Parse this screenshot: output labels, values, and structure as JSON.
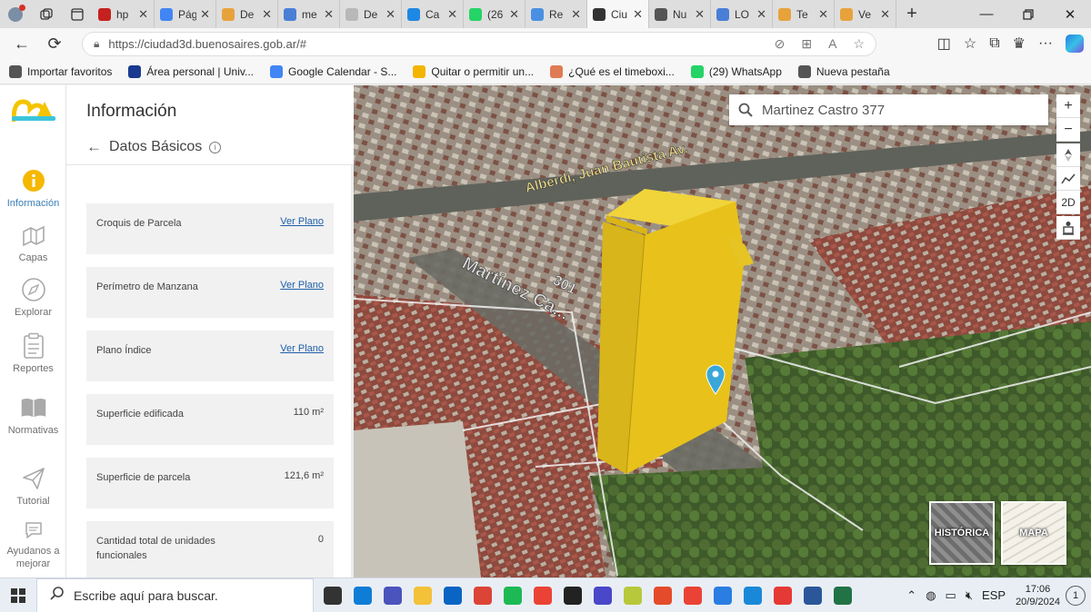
{
  "browser": {
    "tabs": [
      {
        "label": "hp",
        "color": "#c5221f"
      },
      {
        "label": "Pág",
        "color": "#4285f4"
      },
      {
        "label": "De",
        "color": "#e8a23c"
      },
      {
        "label": "me",
        "color": "#4a7fd6"
      },
      {
        "label": "De",
        "color": "#b8b8b8"
      },
      {
        "label": "Ca",
        "color": "#1e88e5"
      },
      {
        "label": "(26",
        "color": "#25d366"
      },
      {
        "label": "Re",
        "color": "#4a90e2"
      },
      {
        "label": "Ciu",
        "color": "#333333"
      },
      {
        "label": "Nu",
        "color": "#555555"
      },
      {
        "label": "LO",
        "color": "#4a7fd6"
      },
      {
        "label": "Te",
        "color": "#e8a23c"
      },
      {
        "label": "Ve",
        "color": "#e8a23c"
      }
    ],
    "active_tab_index": 8,
    "url": "https://ciudad3d.buenosaires.gob.ar/#",
    "favorites": [
      {
        "label": "Importar favoritos",
        "color": "#555555"
      },
      {
        "label": "Área personal | Univ...",
        "color": "#1a3a8f"
      },
      {
        "label": "Google Calendar - S...",
        "color": "#4285f4"
      },
      {
        "label": "Quitar o permitir un...",
        "color": "#f4b400"
      },
      {
        "label": "¿Qué es el timeboxi...",
        "color": "#e07b53"
      },
      {
        "label": "(29) WhatsApp",
        "color": "#25d366"
      },
      {
        "label": "Nueva pestaña",
        "color": "#555555"
      }
    ]
  },
  "rail": {
    "items": [
      {
        "label": "Información",
        "icon": "info-icon"
      },
      {
        "label": "Capas",
        "icon": "layers-icon"
      },
      {
        "label": "Explorar",
        "icon": "compass-icon"
      },
      {
        "label": "Reportes",
        "icon": "clipboard-icon"
      },
      {
        "label": "Normativas",
        "icon": "book-icon"
      },
      {
        "label": "Tutorial",
        "icon": "send-icon"
      },
      {
        "label": "Ayudanos a mejorar",
        "icon": "chat-icon"
      }
    ],
    "accent": "#f5b800"
  },
  "panel": {
    "title": "Información",
    "subtitle": "Datos Básicos",
    "rows": [
      {
        "label": "Croquis de Parcela",
        "value": "Ver Plano",
        "link": true
      },
      {
        "label": "Perímetro de Manzana",
        "value": "Ver Plano",
        "link": true
      },
      {
        "label": "Plano Índice",
        "value": "Ver Plano",
        "link": true
      },
      {
        "label": "Superficie edificada",
        "value": "110 m²",
        "link": false
      },
      {
        "label": "Superficie de parcela",
        "value": "121,6 m²",
        "link": false
      },
      {
        "label": "Cantidad total de unidades funcionales",
        "value": "0",
        "link": false
      }
    ]
  },
  "map": {
    "search_value": "Martinez Castro 377",
    "street_labels": [
      "Alberdi, Juan Bautista Av.",
      "Martinez Ca...",
      "301"
    ],
    "controls": [
      "+",
      "−",
      "2D"
    ],
    "minimaps": [
      "HISTÓRICA",
      "MAPA"
    ],
    "building_color": "#e8c21a"
  },
  "taskbar": {
    "search_placeholder": "Escribe aquí para buscar.",
    "language": "ESP",
    "time": "17:06",
    "date": "20/9/2024",
    "notifications": "1",
    "apps": [
      {
        "name": "task-view",
        "color": "#333333"
      },
      {
        "name": "edge",
        "color": "#0f7dd6"
      },
      {
        "name": "teams",
        "color": "#4b53bc"
      },
      {
        "name": "file-explorer",
        "color": "#f3c238"
      },
      {
        "name": "outlook",
        "color": "#0a64c3"
      },
      {
        "name": "chrome",
        "color": "#db4437"
      },
      {
        "name": "spotify",
        "color": "#1db954"
      },
      {
        "name": "gmail",
        "color": "#ea4335"
      },
      {
        "name": "media-player",
        "color": "#222222"
      },
      {
        "name": "shield-app",
        "color": "#4a47c8"
      },
      {
        "name": "game",
        "color": "#b7c83a"
      },
      {
        "name": "brave",
        "color": "#e44b2b"
      },
      {
        "name": "gmail-2",
        "color": "#ea4335"
      },
      {
        "name": "notes",
        "color": "#2a7de1"
      },
      {
        "name": "tips",
        "color": "#1a88d8"
      },
      {
        "name": "anydesk",
        "color": "#e53935"
      },
      {
        "name": "word",
        "color": "#2b579a"
      },
      {
        "name": "excel",
        "color": "#217346"
      }
    ]
  }
}
